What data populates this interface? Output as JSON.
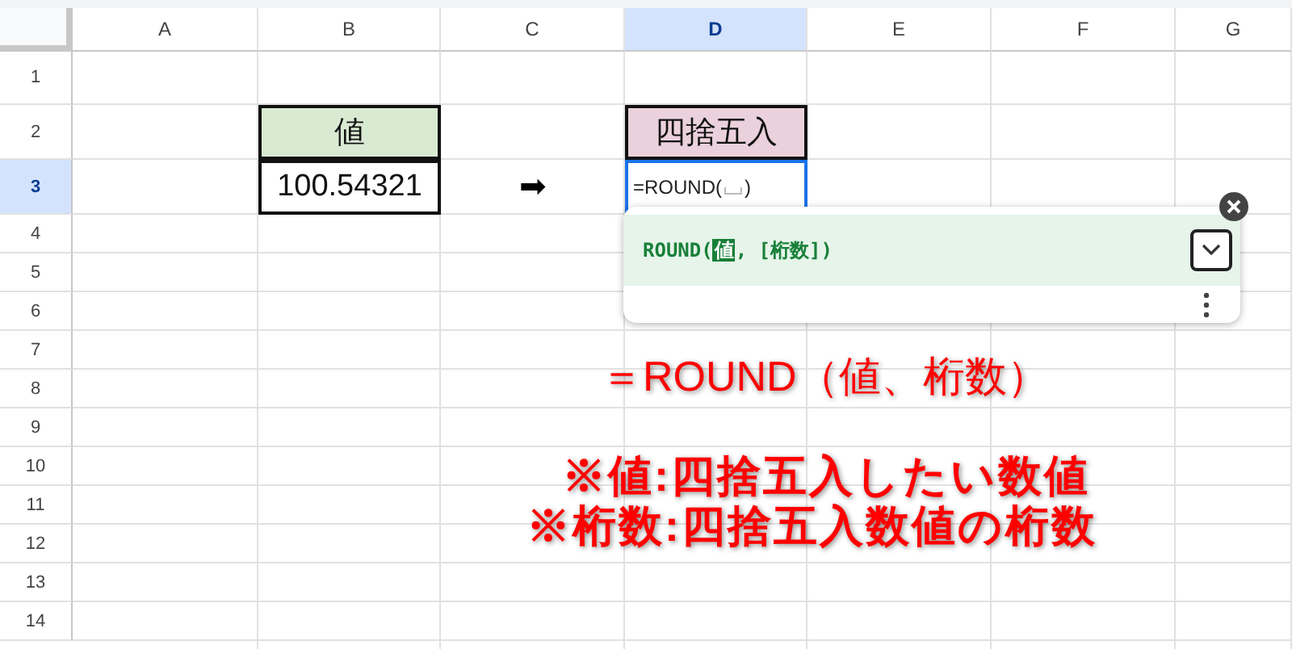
{
  "columns": [
    {
      "label": "A",
      "selected": false
    },
    {
      "label": "B",
      "selected": false
    },
    {
      "label": "C",
      "selected": false
    },
    {
      "label": "D",
      "selected": true
    },
    {
      "label": "E",
      "selected": false
    },
    {
      "label": "F",
      "selected": false
    },
    {
      "label": "G",
      "selected": false
    }
  ],
  "rows": [
    {
      "label": "1",
      "selected": false
    },
    {
      "label": "2",
      "selected": false,
      "cells": [
        {
          "kind": "empty"
        },
        {
          "kind": "label",
          "text": "値",
          "color": "#d9ead3"
        },
        {
          "kind": "empty"
        },
        {
          "kind": "label",
          "text": "四捨五入",
          "color": "#ead1dc"
        },
        {
          "kind": "empty"
        },
        {
          "kind": "empty"
        },
        {
          "kind": "empty"
        }
      ]
    },
    {
      "label": "3",
      "selected": true,
      "cells": [
        {
          "kind": "empty"
        },
        {
          "kind": "value",
          "text": "100.54321"
        },
        {
          "kind": "arrow",
          "text": "➡"
        },
        {
          "kind": "editing",
          "text": "=ROUND(",
          "suffix": ")"
        },
        {
          "kind": "empty"
        },
        {
          "kind": "empty"
        },
        {
          "kind": "empty"
        }
      ]
    },
    {
      "label": "4",
      "selected": false
    },
    {
      "label": "5",
      "selected": false
    },
    {
      "label": "6",
      "selected": false
    },
    {
      "label": "7",
      "selected": false
    },
    {
      "label": "8",
      "selected": false
    },
    {
      "label": "9",
      "selected": false
    },
    {
      "label": "10",
      "selected": false
    },
    {
      "label": "11",
      "selected": false
    },
    {
      "label": "12",
      "selected": false
    },
    {
      "label": "13",
      "selected": false
    },
    {
      "label": "14",
      "selected": false
    }
  ],
  "formula_help": {
    "function": "ROUND(",
    "current_argument": "値",
    "rest": ", [桁数])"
  },
  "annotations": {
    "syntax": "＝ROUND（値、桁数）",
    "notes": [
      "※値:四捨五入したい数値",
      "※桁数:四捨五入数値の桁数"
    ]
  }
}
